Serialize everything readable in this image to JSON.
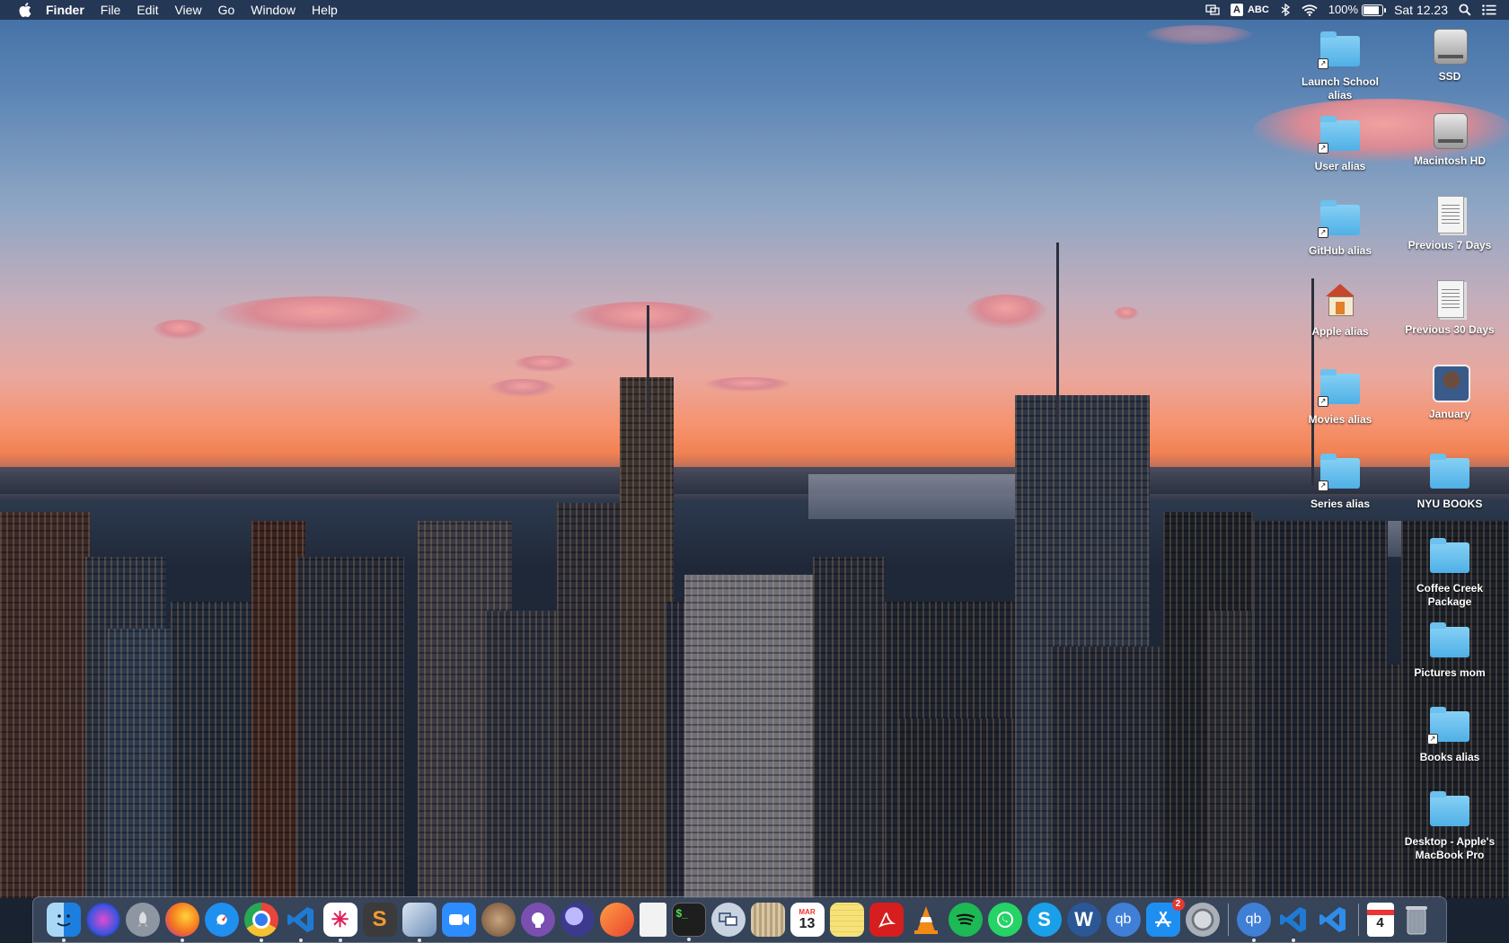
{
  "menubar": {
    "apple_icon": "apple-icon",
    "app_name": "Finder",
    "menus": [
      "File",
      "Edit",
      "View",
      "Go",
      "Window",
      "Help"
    ],
    "status": {
      "input_source": "ABC",
      "battery_percent": "100%",
      "clock": "Sat 12.23"
    }
  },
  "desktop_icons": [
    {
      "label": "Launch School alias",
      "kind": "folder-alias"
    },
    {
      "label": "SSD",
      "kind": "drive"
    },
    {
      "label": "User alias",
      "kind": "folder-alias"
    },
    {
      "label": "Macintosh HD",
      "kind": "drive"
    },
    {
      "label": "GitHub alias",
      "kind": "folder-alias"
    },
    {
      "label": "Previous 7 Days",
      "kind": "document"
    },
    {
      "label": "Apple alias",
      "kind": "home-alias"
    },
    {
      "label": "Previous 30 Days",
      "kind": "document"
    },
    {
      "label": "Movies alias",
      "kind": "folder-alias"
    },
    {
      "label": "January",
      "kind": "photo"
    },
    {
      "label": "Series alias",
      "kind": "folder-alias"
    },
    {
      "label": "NYU BOOKS",
      "kind": "folder"
    },
    {
      "label": "Coffee Creek Package",
      "kind": "folder"
    },
    {
      "label": "Pictures mom",
      "kind": "folder"
    },
    {
      "label": "Books alias",
      "kind": "folder-alias"
    },
    {
      "label": "Desktop - Apple's MacBook Pro",
      "kind": "folder"
    }
  ],
  "dock": {
    "apps": [
      {
        "name": "finder-icon",
        "color": "#2e8de0"
      },
      {
        "name": "siri-icon",
        "color": "#5d4fd6"
      },
      {
        "name": "launchpad-icon",
        "color": "#8e96a2"
      },
      {
        "name": "firefox-icon",
        "color": "#f5781f"
      },
      {
        "name": "safari-icon",
        "color": "#1f8ff0"
      },
      {
        "name": "chrome-icon",
        "color": "#e8453c"
      },
      {
        "name": "vscode-icon",
        "color": "#1f7ad4"
      },
      {
        "name": "slack-icon",
        "color": "#e9e6ea"
      },
      {
        "name": "sublime-text-icon",
        "color": "#f29b32"
      },
      {
        "name": "preview-icon",
        "color": "#7aa3cf"
      },
      {
        "name": "zoom-icon",
        "color": "#2d8cff"
      },
      {
        "name": "bear-icon",
        "color": "#6b4b32"
      },
      {
        "name": "github-desktop-icon",
        "color": "#7a4fb0"
      },
      {
        "name": "nightowl-icon",
        "color": "#3b3a8c"
      },
      {
        "name": "pixelmator-icon",
        "color": "#f06a2c"
      },
      {
        "name": "textedit-document-icon",
        "color": "#eeeeee"
      },
      {
        "name": "terminal-icon",
        "color": "#1e1e1e"
      },
      {
        "name": "screen-sharing-icon",
        "color": "#c9d3e0"
      },
      {
        "name": "notefile-icon",
        "color": "#b8a07a"
      },
      {
        "name": "calendar-icon",
        "color": "#ffffff"
      },
      {
        "name": "notes-icon",
        "color": "#f6e27a"
      },
      {
        "name": "acrobat-icon",
        "color": "#d61e1e"
      },
      {
        "name": "vlc-icon",
        "color": "#f28a16"
      },
      {
        "name": "spotify-icon",
        "color": "#1db954"
      },
      {
        "name": "whatsapp-icon",
        "color": "#25d366"
      },
      {
        "name": "skype-icon",
        "color": "#1aa0e8"
      },
      {
        "name": "word-icon",
        "color": "#2b5797"
      },
      {
        "name": "qbittorrent-icon",
        "color": "#3f7fd6"
      },
      {
        "name": "app-store-icon",
        "color": "#1e8ff0",
        "badge": "2"
      },
      {
        "name": "system-preferences-icon",
        "color": "#8a8f98"
      }
    ],
    "recents": [
      {
        "name": "qbittorrent-recent-icon",
        "color": "#3f7fd6"
      },
      {
        "name": "vscode-recent-icon",
        "color": "#1f7ad4"
      },
      {
        "name": "vscode-insiders-icon",
        "color": "#1f7ad4"
      }
    ],
    "stacks": [
      {
        "name": "calendar-stack-icon",
        "color": "#ffffff"
      },
      {
        "name": "trash-icon",
        "color": "#aeb6c0"
      }
    ],
    "calendar_month": "MAR",
    "calendar_day": "13",
    "stack_day": "4",
    "slack_glyph": "✳",
    "sublime_glyph": "S",
    "word_glyph": "W",
    "qb_glyph": "qb",
    "skype_glyph": "S",
    "terminal_glyph": "$_"
  }
}
